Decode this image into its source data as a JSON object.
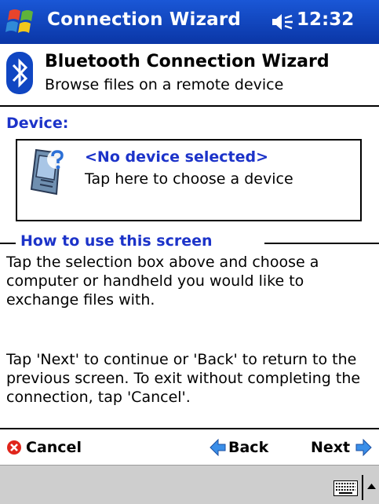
{
  "titlebar": {
    "app_title": "Connection Wizard",
    "clock": "12:32"
  },
  "header": {
    "title": "Bluetooth Connection Wizard",
    "subtitle": "Browse files on a remote device"
  },
  "device": {
    "label": "Device:",
    "name": "<No device selected>",
    "hint": "Tap here to choose a device"
  },
  "help": {
    "title": "How to use this screen",
    "paragraph1": "Tap the selection box above and choose a computer or handheld you would like to exchange files with.",
    "paragraph2": "Tap 'Next' to continue or 'Back' to return to the previous screen. To exit without completing the connection, tap 'Cancel'."
  },
  "actions": {
    "cancel": "Cancel",
    "back": "Back",
    "next": "Next"
  },
  "colors": {
    "titlebar": "#0f3fb8",
    "accent_text": "#1c33c9",
    "menubar": "#cecece"
  }
}
